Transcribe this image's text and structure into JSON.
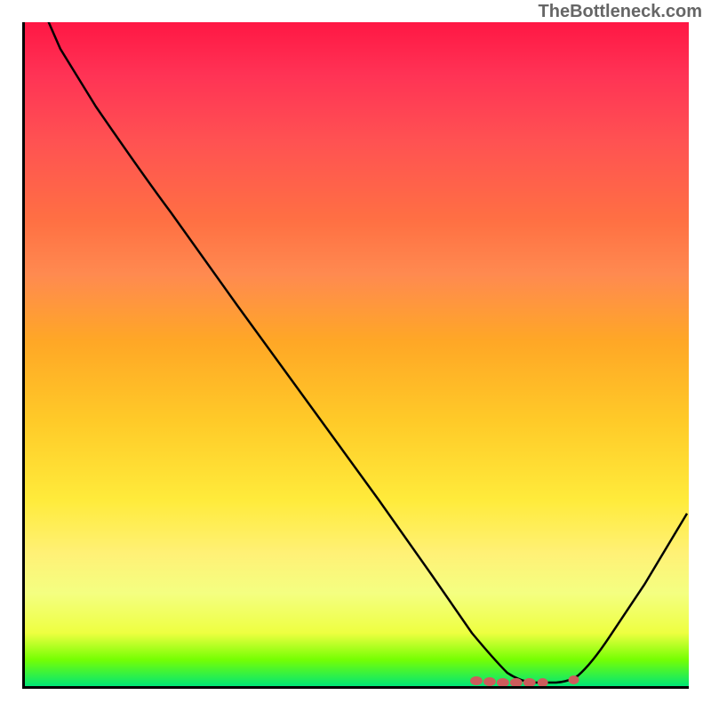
{
  "watermark": "TheBottleneck.com",
  "chart_data": {
    "type": "line",
    "title": "",
    "xlabel": "",
    "ylabel": "",
    "xlim": [
      0,
      100
    ],
    "ylim": [
      0,
      100
    ],
    "description": "Bottleneck curve over gradient background (red=high bottleneck, green=low). Curve shows high values on left descending to minimum valley around x≈75 then rising again on right.",
    "series": [
      {
        "name": "bottleneck-curve",
        "x": [
          0,
          6,
          12,
          18,
          24,
          32,
          40,
          48,
          56,
          62,
          67,
          70,
          73,
          76,
          79,
          82,
          86,
          90,
          94,
          98,
          100
        ],
        "values": [
          110,
          100,
          90,
          80,
          72,
          61,
          50,
          39,
          28,
          19,
          11,
          5,
          1,
          0,
          0,
          1,
          5,
          12,
          20,
          28,
          32
        ]
      },
      {
        "name": "valley-markers",
        "x": [
          67,
          70,
          73,
          76,
          79,
          82
        ],
        "values": [
          2,
          1,
          0.5,
          0.5,
          0.5,
          1
        ]
      }
    ],
    "colors": {
      "top": "#ff1744",
      "bottom": "#00e676",
      "curve": "#000000",
      "markers": "#cd5c5c"
    }
  }
}
